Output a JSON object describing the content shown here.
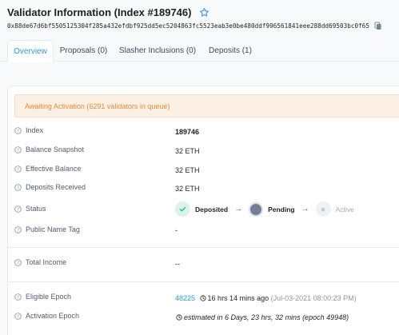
{
  "header": {
    "title": "Validator Information (Index #189746)",
    "address": "0x88de67d6bf5505125304f285a432efdbf925dd5ec5204863fc5523eab3e0be480ddf996561841eee288dd69503bc0f65"
  },
  "tabs": [
    {
      "label": "Overview",
      "active": true
    },
    {
      "label": "Proposals (0)",
      "active": false
    },
    {
      "label": "Slasher Inclusions (0)",
      "active": false
    },
    {
      "label": "Deposits (1)",
      "active": false
    }
  ],
  "alert": "Awaiting Activation (6291 validators in queue)",
  "fields": {
    "index": {
      "label": "Index",
      "value": "189746"
    },
    "balance_snapshot": {
      "label": "Balance Snapshot",
      "value": "32 ETH"
    },
    "effective_balance": {
      "label": "Effective Balance",
      "value": "32 ETH"
    },
    "deposits_received": {
      "label": "Deposits Received",
      "value": "32 ETH"
    },
    "status": {
      "label": "Status"
    },
    "public_name_tag": {
      "label": "Public Name Tag",
      "value": "-"
    },
    "total_income": {
      "label": "Total Income",
      "value": "--"
    },
    "eligible_epoch": {
      "label": "Eligible Epoch",
      "epoch": "48225",
      "relative": "16 hrs 14 mins ago",
      "date": "(Jul-03-2021 08:00:23 PM)"
    },
    "activation_epoch": {
      "label": "Activation Epoch",
      "value": "estimated in 6 Days, 23 hrs, 32 mins (epoch 49948)"
    }
  },
  "status_flow": {
    "deposited": "Deposited",
    "pending": "Pending",
    "active": "Active",
    "arrow": "→"
  },
  "colors": {
    "accent": "#3498db",
    "warning_text": "#e48c3c",
    "warning_bg": "#fcefe3",
    "success": "#00c9a7",
    "pending": "#737f97"
  }
}
